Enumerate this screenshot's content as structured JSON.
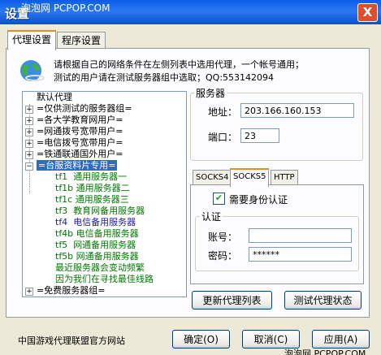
{
  "window": {
    "title": "设置",
    "close_label": "X"
  },
  "watermarks": {
    "top": "泡泡网 PCPOP.COM",
    "bottom": "泡泡网 PCPOP.COM"
  },
  "tabs": [
    {
      "label": "代理设置"
    },
    {
      "label": "程序设置"
    }
  ],
  "info": {
    "icon": "globe-icon",
    "line1": "请根据自己的网络条件在左侧列表中选用代理，一个帐号通用；",
    "line2": "测试的用户请在测试服务器组中选取；QQ:553142094"
  },
  "tree": {
    "root": "默认代理",
    "groups": [
      "=仅供测试的服务器组=",
      "=各大学教育网用户=",
      "=网通拨号宽带用户=",
      "=电信拨号宽带用户=",
      "=铁通联通国外用户="
    ],
    "expanded": "=台服资料片专用=",
    "children": [
      {
        "id": "tf1",
        "name": "通用服务器一"
      },
      {
        "id": "tf1b",
        "name": "通用服务器二"
      },
      {
        "id": "tf1c",
        "name": "通用服务器三"
      },
      {
        "id": "tf3",
        "name": "教育网备用服务器"
      },
      {
        "id": "tf4",
        "name": "电信备用服务器"
      },
      {
        "id": "tf4b",
        "name": "电信备用服务器"
      },
      {
        "id": "tf5",
        "name": "网通备用服务器"
      },
      {
        "id": "tf5b",
        "name": "网通备用服务器"
      }
    ],
    "notes": [
      "最近服务器会变动频繁",
      "因为我们在寻找最佳线路"
    ],
    "last": "=免费服务器组="
  },
  "server": {
    "group_label": "服务器",
    "address_label": "地址：",
    "address": "203.166.160.153",
    "port_label": "端口：",
    "port": "23"
  },
  "proxy_tabs": [
    {
      "label": "SOCKS4"
    },
    {
      "label": "SOCKS5"
    },
    {
      "label": "HTTP"
    }
  ],
  "auth": {
    "need_auth_label": "需要身份认证",
    "need_auth_checked": true,
    "group_label": "认证",
    "account_label": "账号：",
    "account": "",
    "password_label": "密码：",
    "password": "******"
  },
  "buttons": {
    "refresh": "更新代理列表",
    "test": "测试代理状态",
    "ok": "确定(O)",
    "cancel": "取消(C)",
    "apply": "应用(A)"
  },
  "footer": "中国游戏代理联盟官方网站",
  "colors": {
    "selection": "#316ac5",
    "child_text": "#007a00",
    "title_bar": "#0a5ce8"
  }
}
